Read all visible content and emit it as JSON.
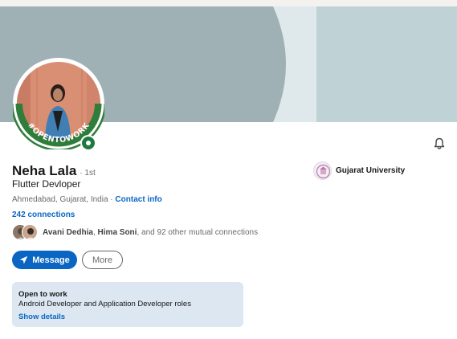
{
  "profile": {
    "name": "Neha Lala",
    "degree": "· 1st",
    "headline": "Flutter Devloper",
    "location": "Ahmedabad, Gujarat, India",
    "separator": " · ",
    "contact_info_label": "Contact info",
    "connections": "242 connections",
    "open_to_work_badge": "#OPENTOWORK",
    "online_status": "online"
  },
  "mutual": {
    "prefix_names": [
      "Avani Dedhia",
      "Hima Soni"
    ],
    "joiner": ", ",
    "suffix": ", and 92 other mutual connections"
  },
  "actions": {
    "message_label": "Message",
    "more_label": "More"
  },
  "open_to_work": {
    "title": "Open to work",
    "roles": "Android Developer and Application Developer roles",
    "link_label": "Show details"
  },
  "education": {
    "school_name": "Gujarat University"
  },
  "icons": {
    "bell": "bell-icon",
    "message": "paper-plane-icon"
  },
  "colors": {
    "accent": "#0a66c2",
    "open_to_work_green": "#1f7a3f",
    "cover_teal": "#9fb1b5",
    "card_bg": "#dde7f1"
  }
}
